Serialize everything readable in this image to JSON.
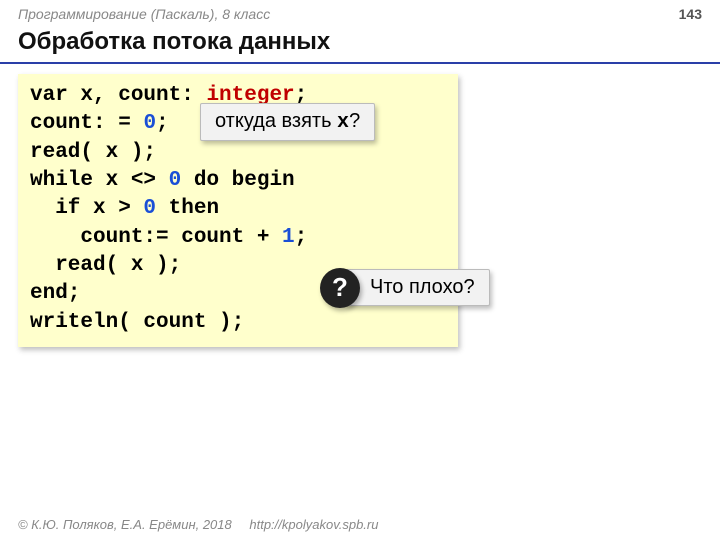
{
  "header": {
    "course": "Программирование (Паскаль), 8 класс",
    "page": "143"
  },
  "title": "Обработка потока данных",
  "code": {
    "l1_a": "var x",
    "l1_b": ", count: ",
    "l1_type": "integer",
    "l1_c": ";",
    "l2_a": "count:",
    "l2_b": " = ",
    "l2_num": "0",
    "l2_c": ";",
    "l3": "read( x );",
    "l4_a": "while x <> ",
    "l4_num": "0",
    "l4_b": " do begin",
    "l5_a": "  if x > ",
    "l5_num": "0",
    "l5_b": " then",
    "l6_a": "    count:= count + ",
    "l6_num": "1",
    "l6_b": ";",
    "l7": "  read( x );",
    "l8": "end;",
    "l9": "writeln( count );"
  },
  "annotations": {
    "a1_pre": "откуда взять ",
    "a1_mono": "x",
    "a1_post": "?",
    "a2_q": "?",
    "a2_text": "Что плохо?"
  },
  "footer": {
    "copyright": "© К.Ю. Поляков, Е.А. Ерёмин, 2018",
    "url": "http://kpolyakov.spb.ru"
  }
}
